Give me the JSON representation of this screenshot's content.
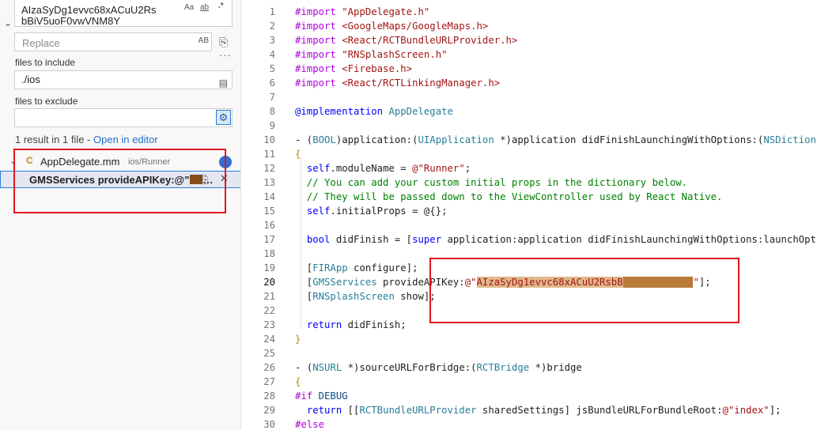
{
  "search": {
    "query_line1": "AIzaSyDg1evvc68xACuU2Rs",
    "query_line2": "bBiV5uoF0vwVNM8Y",
    "opt_case": "Aa",
    "opt_word": "ab",
    "opt_regex": ".*",
    "replace_placeholder": "Replace",
    "replace_ab": "AB",
    "more": "···",
    "include_label": "files to include",
    "include_value": "./ios",
    "exclude_label": "files to exclude",
    "exclude_value": ""
  },
  "results": {
    "summary": "1 result in 1 file - ",
    "open_link": "Open in editor",
    "file_icon": "c-file-icon",
    "file_name": "AppDelegate.mm",
    "file_path": "ios/Runner",
    "match_text": "GMSServices provideAPIKey:@\"",
    "match_ellipsis": "…"
  },
  "colors": {
    "accent": "#2a7fd7",
    "annotation": "#e0161e",
    "redaction": "#b97a3a"
  },
  "editor": {
    "active_line": 20,
    "lines": [
      {
        "n": 1,
        "t": "#import \"AppDelegate.h\""
      },
      {
        "n": 2,
        "t": "#import <GoogleMaps/GoogleMaps.h>"
      },
      {
        "n": 3,
        "t": "#import <React/RCTBundleURLProvider.h>"
      },
      {
        "n": 4,
        "t": "#import \"RNSplashScreen.h\""
      },
      {
        "n": 5,
        "t": "#import <Firebase.h>"
      },
      {
        "n": 6,
        "t": "#import <React/RCTLinkingManager.h>"
      },
      {
        "n": 7,
        "t": ""
      },
      {
        "n": 8,
        "t": "@implementation AppDelegate"
      },
      {
        "n": 9,
        "t": ""
      },
      {
        "n": 10,
        "t": "- (BOOL)application:(UIApplication *)application didFinishLaunchingWithOptions:(NSDictionary *)launchOptions"
      },
      {
        "n": 11,
        "t": "{"
      },
      {
        "n": 12,
        "t": "  self.moduleName = @\"Runner\";"
      },
      {
        "n": 13,
        "t": "  // You can add your custom initial props in the dictionary below."
      },
      {
        "n": 14,
        "t": "  // They will be passed down to the ViewController used by React Native."
      },
      {
        "n": 15,
        "t": "  self.initialProps = @{};"
      },
      {
        "n": 16,
        "t": ""
      },
      {
        "n": 17,
        "t": "  bool didFinish = [super application:application didFinishLaunchingWithOptions:launchOptions];"
      },
      {
        "n": 18,
        "t": ""
      },
      {
        "n": 19,
        "t": "  [FIRApp configure];"
      },
      {
        "n": 20,
        "t": "  [GMSServices provideAPIKey:@\"AIzaSyDg1evvc68xACuU2RsbB\"];"
      },
      {
        "n": 21,
        "t": "  [RNSplashScreen show];"
      },
      {
        "n": 22,
        "t": ""
      },
      {
        "n": 23,
        "t": "  return didFinish;"
      },
      {
        "n": 24,
        "t": "}"
      },
      {
        "n": 25,
        "t": ""
      },
      {
        "n": 26,
        "t": "- (NSURL *)sourceURLForBridge:(RCTBridge *)bridge"
      },
      {
        "n": 27,
        "t": "{"
      },
      {
        "n": 28,
        "t": "#if DEBUG"
      },
      {
        "n": 29,
        "t": "  return [[RCTBundleURLProvider sharedSettings] jsBundleURLForBundleRoot:@\"index\"];"
      },
      {
        "n": 30,
        "t": "#else"
      }
    ]
  }
}
